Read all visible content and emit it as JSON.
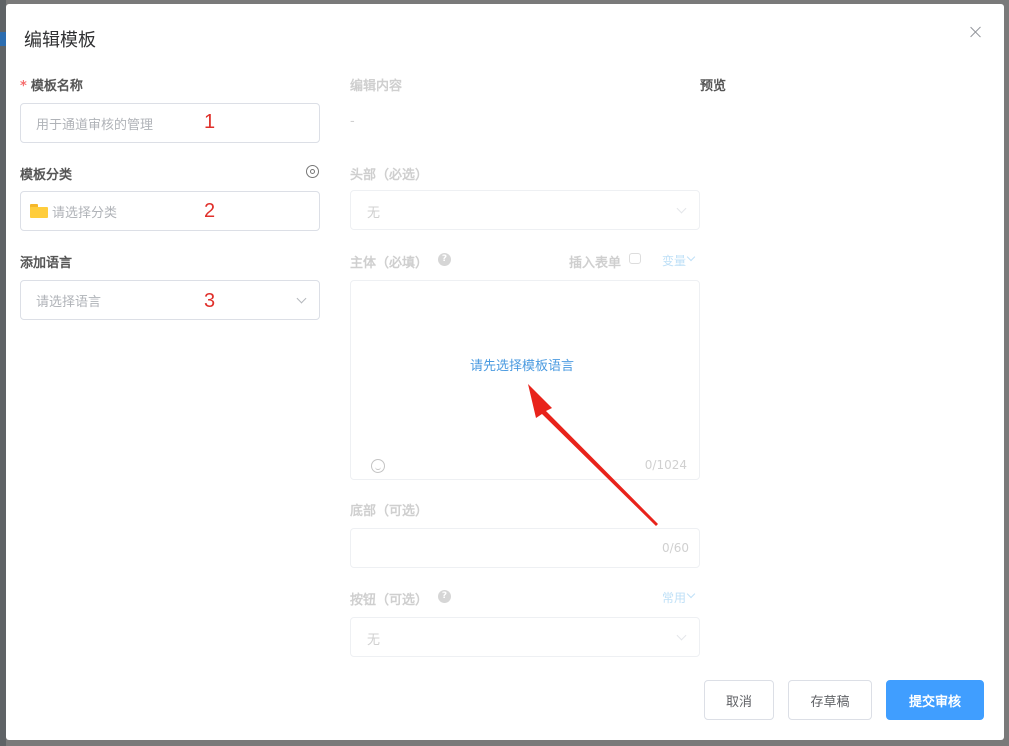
{
  "dialog": {
    "title": "编辑模板",
    "close_icon": "close-icon"
  },
  "left": {
    "template_name": {
      "label": "模板名称",
      "required_mark": "*",
      "placeholder": "用于通道审核的管理",
      "annotation": "1"
    },
    "template_category": {
      "label": "模板分类",
      "placeholder": "请选择分类",
      "annotation": "2",
      "icons": [
        "folder-icon",
        "gear-icon"
      ]
    },
    "add_language": {
      "label": "添加语言",
      "placeholder": "请选择语言",
      "annotation": "3"
    }
  },
  "middle": {
    "section_title": "编辑内容",
    "dash": "-",
    "header": {
      "label": "头部（必选）",
      "value": "无"
    },
    "body": {
      "label": "主体（必填）",
      "help_icon": "?",
      "insert_form": "插入表单",
      "variable": "变量",
      "hint": "请先选择模板语言",
      "counter": "0/1024"
    },
    "footer": {
      "label": "底部（可选）",
      "counter": "0/60"
    },
    "button": {
      "label": "按钮（可选）",
      "help_icon": "?",
      "common": "常用",
      "value": "无"
    }
  },
  "preview": {
    "title": "预览"
  },
  "footer_buttons": {
    "cancel": "取消",
    "save_draft": "存草稿",
    "submit": "提交审核"
  },
  "colors": {
    "primary": "#409eff",
    "required": "#f56c6c",
    "annotation_red": "#e0302b",
    "hint_blue": "#4b9be0"
  }
}
